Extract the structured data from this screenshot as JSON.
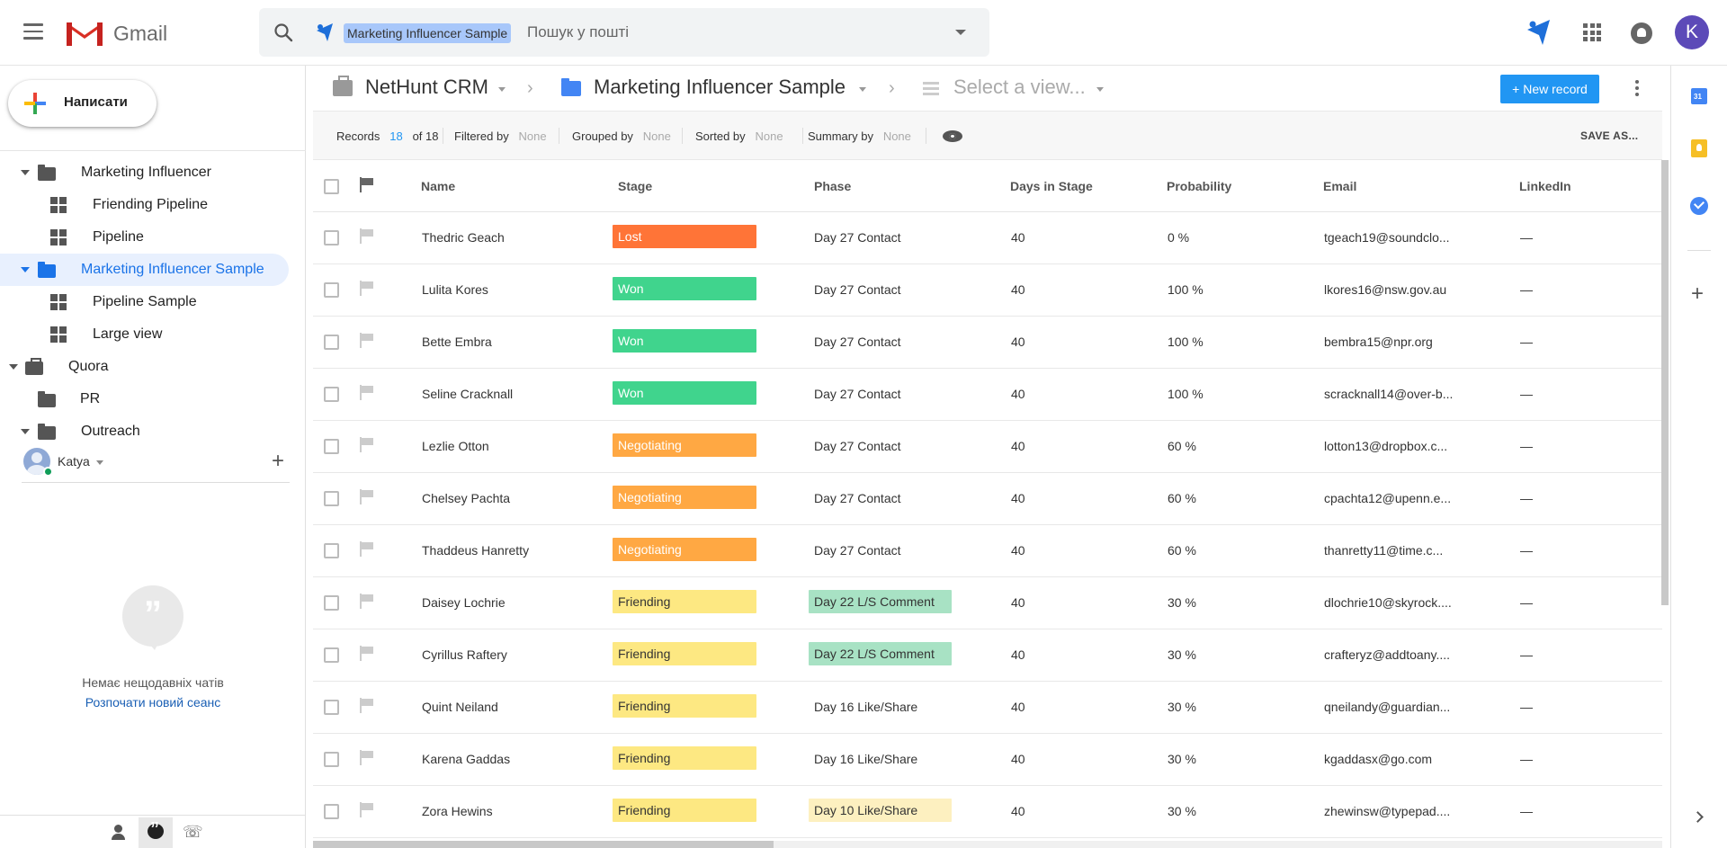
{
  "gmail": {
    "logo_text": "Gmail",
    "search_chip": "Marketing Influencer Sample",
    "search_placeholder": "Пошук у пошті",
    "avatar_letter": "K"
  },
  "sidebar": {
    "compose_label": "Написати",
    "tree": [
      {
        "label": "Marketing Influencer",
        "icon": "folder-icon",
        "expanded": true
      },
      {
        "label": "Friending Pipeline",
        "icon": "view-grid-icon"
      },
      {
        "label": "Pipeline",
        "icon": "view-grid-icon"
      },
      {
        "label": "Marketing Influencer Sample",
        "icon": "folder-icon",
        "expanded": true,
        "active": true
      },
      {
        "label": "Pipeline Sample",
        "icon": "view-grid-icon"
      },
      {
        "label": "Large view",
        "icon": "view-grid-icon"
      },
      {
        "label": "Quora",
        "icon": "briefcase-icon",
        "expanded": true
      },
      {
        "label": "PR",
        "icon": "folder-icon"
      },
      {
        "label": "Outreach",
        "icon": "folder-icon",
        "expanded": true
      }
    ],
    "user_name": "Katya",
    "chat_empty_text": "Немає нещодавніх чатів",
    "chat_start_link": "Розпочати новий сеанс"
  },
  "breadcrumb": {
    "workspace": "NetHunt CRM",
    "folder": "Marketing Influencer Sample",
    "view_placeholder": "Select a view...",
    "new_record_label": "+ New record"
  },
  "filters": {
    "records_label": "Records",
    "records_count": "18",
    "records_total": "of 18",
    "filtered_label": "Filtered by",
    "filtered_value": "None",
    "grouped_label": "Grouped by",
    "grouped_value": "None",
    "sorted_label": "Sorted by",
    "sorted_value": "None",
    "summary_label": "Summary by",
    "summary_value": "None",
    "save_as_label": "SAVE AS..."
  },
  "table": {
    "columns": [
      "Name",
      "Stage",
      "Phase",
      "Days in Stage",
      "Probability",
      "Email",
      "LinkedIn"
    ],
    "stage_colors": {
      "Lost": "#ff7437",
      "Won": "#40d48d",
      "Negotiating": "#ffa843",
      "Friending": "#fde882"
    },
    "phase_colors": {
      "Day 22 L/S Comment": "#a8e2c4",
      "Day 10 Like/Share": "#fdf0c0"
    },
    "rows": [
      {
        "name": "Thedric Geach",
        "stage": "Lost",
        "phase": "Day 27 Contact",
        "days": "40",
        "probability": "0 %",
        "email": "tgeach19@soundclo...",
        "linkedin": "—"
      },
      {
        "name": "Lulita Kores",
        "stage": "Won",
        "phase": "Day 27 Contact",
        "days": "40",
        "probability": "100 %",
        "email": "lkores16@nsw.gov.au",
        "linkedin": "—"
      },
      {
        "name": "Bette Embra",
        "stage": "Won",
        "phase": "Day 27 Contact",
        "days": "40",
        "probability": "100 %",
        "email": "bembra15@npr.org",
        "linkedin": "—"
      },
      {
        "name": "Seline Cracknall",
        "stage": "Won",
        "phase": "Day 27 Contact",
        "days": "40",
        "probability": "100 %",
        "email": "scracknall14@over-b...",
        "linkedin": "—"
      },
      {
        "name": "Lezlie Otton",
        "stage": "Negotiating",
        "phase": "Day 27 Contact",
        "days": "40",
        "probability": "60 %",
        "email": "lotton13@dropbox.c...",
        "linkedin": "—"
      },
      {
        "name": "Chelsey Pachta",
        "stage": "Negotiating",
        "phase": "Day 27 Contact",
        "days": "40",
        "probability": "60 %",
        "email": "cpachta12@upenn.e...",
        "linkedin": "—"
      },
      {
        "name": "Thaddeus Hanretty",
        "stage": "Negotiating",
        "phase": "Day 27 Contact",
        "days": "40",
        "probability": "60 %",
        "email": "thanretty11@time.c...",
        "linkedin": "—"
      },
      {
        "name": "Daisey Lochrie",
        "stage": "Friending",
        "phase": "Day 22 L/S Comment",
        "days": "40",
        "probability": "30 %",
        "email": "dlochrie10@skyrock....",
        "linkedin": "—"
      },
      {
        "name": "Cyrillus Raftery",
        "stage": "Friending",
        "phase": "Day 22 L/S Comment",
        "days": "40",
        "probability": "30 %",
        "email": "crafteryz@addtoany....",
        "linkedin": "—"
      },
      {
        "name": "Quint Neiland",
        "stage": "Friending",
        "phase": "Day 16 Like/Share",
        "days": "40",
        "probability": "30 %",
        "email": "qneilandy@guardian...",
        "linkedin": "—"
      },
      {
        "name": "Karena Gaddas",
        "stage": "Friending",
        "phase": "Day 16 Like/Share",
        "days": "40",
        "probability": "30 %",
        "email": "kgaddasx@go.com",
        "linkedin": "—"
      },
      {
        "name": "Zora Hewins",
        "stage": "Friending",
        "phase": "Day 10 Like/Share",
        "days": "40",
        "probability": "30 %",
        "email": "zhewinsw@typepad....",
        "linkedin": "—"
      }
    ]
  }
}
